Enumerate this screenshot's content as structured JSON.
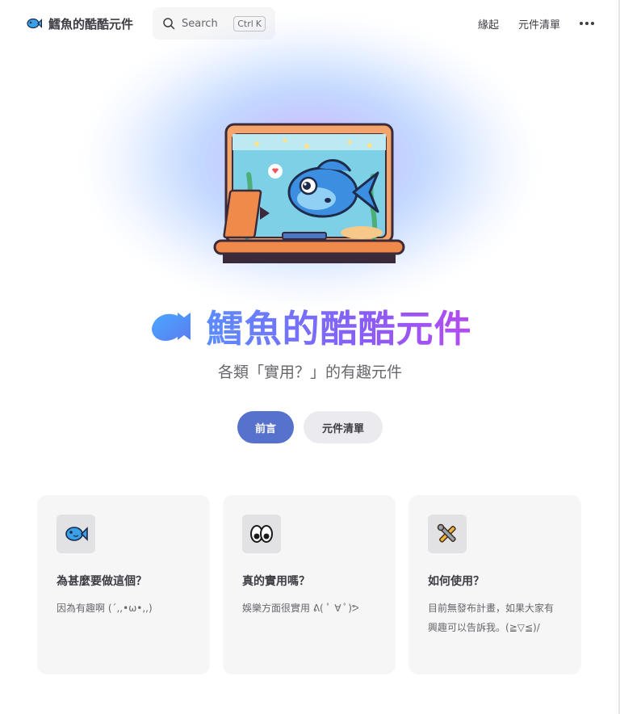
{
  "nav": {
    "site_title": "鱈魚的酷酷元件",
    "search_label": "Search",
    "search_kbd": [
      "Ctrl",
      "K"
    ],
    "links": [
      "緣起",
      "元件清單"
    ]
  },
  "hero": {
    "name": "鱈魚的酷酷元件",
    "tagline": "各類「實用？」的有趣元件",
    "actions": [
      {
        "label": "前言",
        "theme": "brand"
      },
      {
        "label": "元件清單",
        "theme": "alt"
      }
    ]
  },
  "features": [
    {
      "icon": "fish-icon",
      "title": "為甚麼要做這個？",
      "details": "因為有趣啊 (´,,•ω•,,)"
    },
    {
      "icon": "eyes-icon",
      "title": "真的實用嗎？",
      "details": "娛樂方面很實用 ᕕ( ﾟ ∀ ﾟ)ᕗ"
    },
    {
      "icon": "tools-icon",
      "title": "如何使用？",
      "details": "目前無發布計畫，如果大家有興趣可以告訴我。(≧▽≦)/"
    }
  ],
  "colors": {
    "brand": "#5672cd",
    "gradient_start": "#5b8cff",
    "gradient_end": "#b44bf0",
    "card_bg": "#f6f6f7"
  }
}
